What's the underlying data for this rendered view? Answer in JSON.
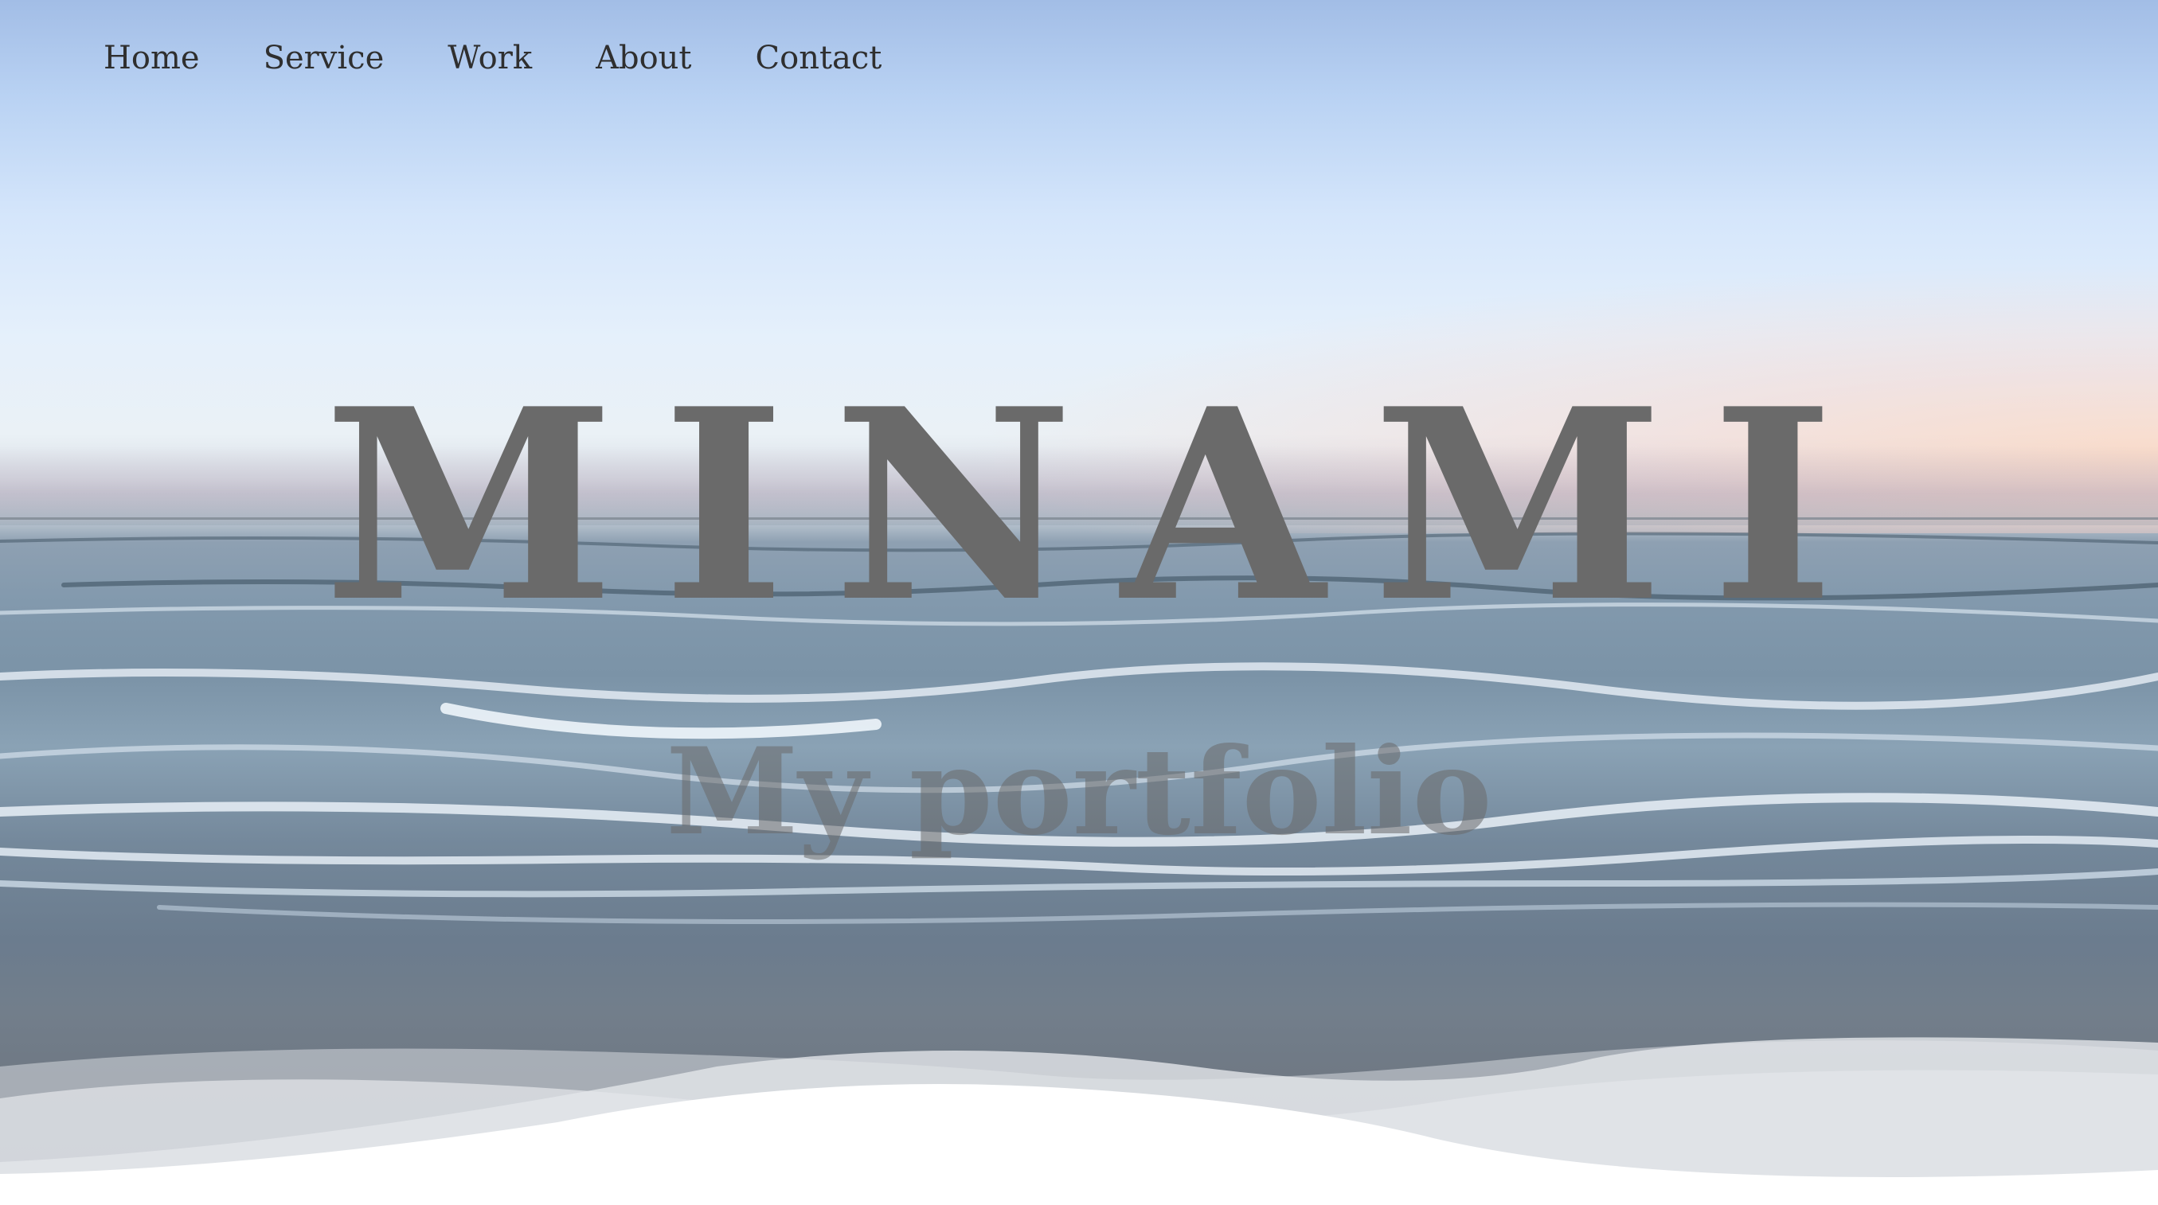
{
  "nav": {
    "items": [
      {
        "label": "Home"
      },
      {
        "label": "Service"
      },
      {
        "label": "Work"
      },
      {
        "label": "About"
      },
      {
        "label": "Contact"
      }
    ]
  },
  "hero": {
    "title": "MINAMI",
    "subtitle": "My portfolio"
  },
  "colors": {
    "title": "#6a6a6a",
    "nav_text": "#2f2f2f",
    "footer_wave": "#ffffff"
  }
}
